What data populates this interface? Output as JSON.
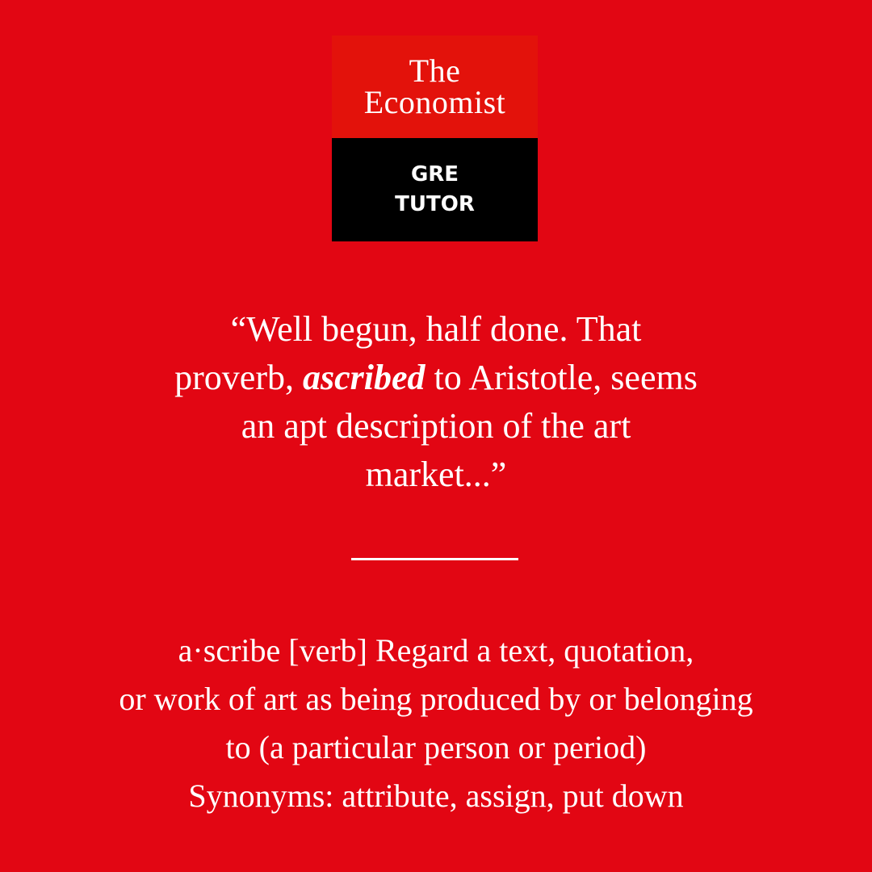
{
  "logo": {
    "title_line1": "The",
    "title_line2": "Economist",
    "subtitle_line1": "GRE",
    "subtitle_line2": "TUTOR"
  },
  "quote": {
    "line1": "“Well begun, half done. That",
    "line2_before": "proverb, ",
    "keyword": "ascribed",
    "line2_after": " to Aristotle, seems",
    "line3": "an apt description of the art",
    "line4": "market...”"
  },
  "definition": {
    "line1": "a·scribe [verb] Regard a text, quotation,",
    "line2": "or work of art as being produced by or belonging",
    "line3": "to (a particular person or period)",
    "line4": "Synonyms: attribute, assign, put down"
  },
  "colors": {
    "background": "#e20613",
    "logo_red": "#e3120b",
    "logo_black": "#000000",
    "text": "#ffffff"
  }
}
